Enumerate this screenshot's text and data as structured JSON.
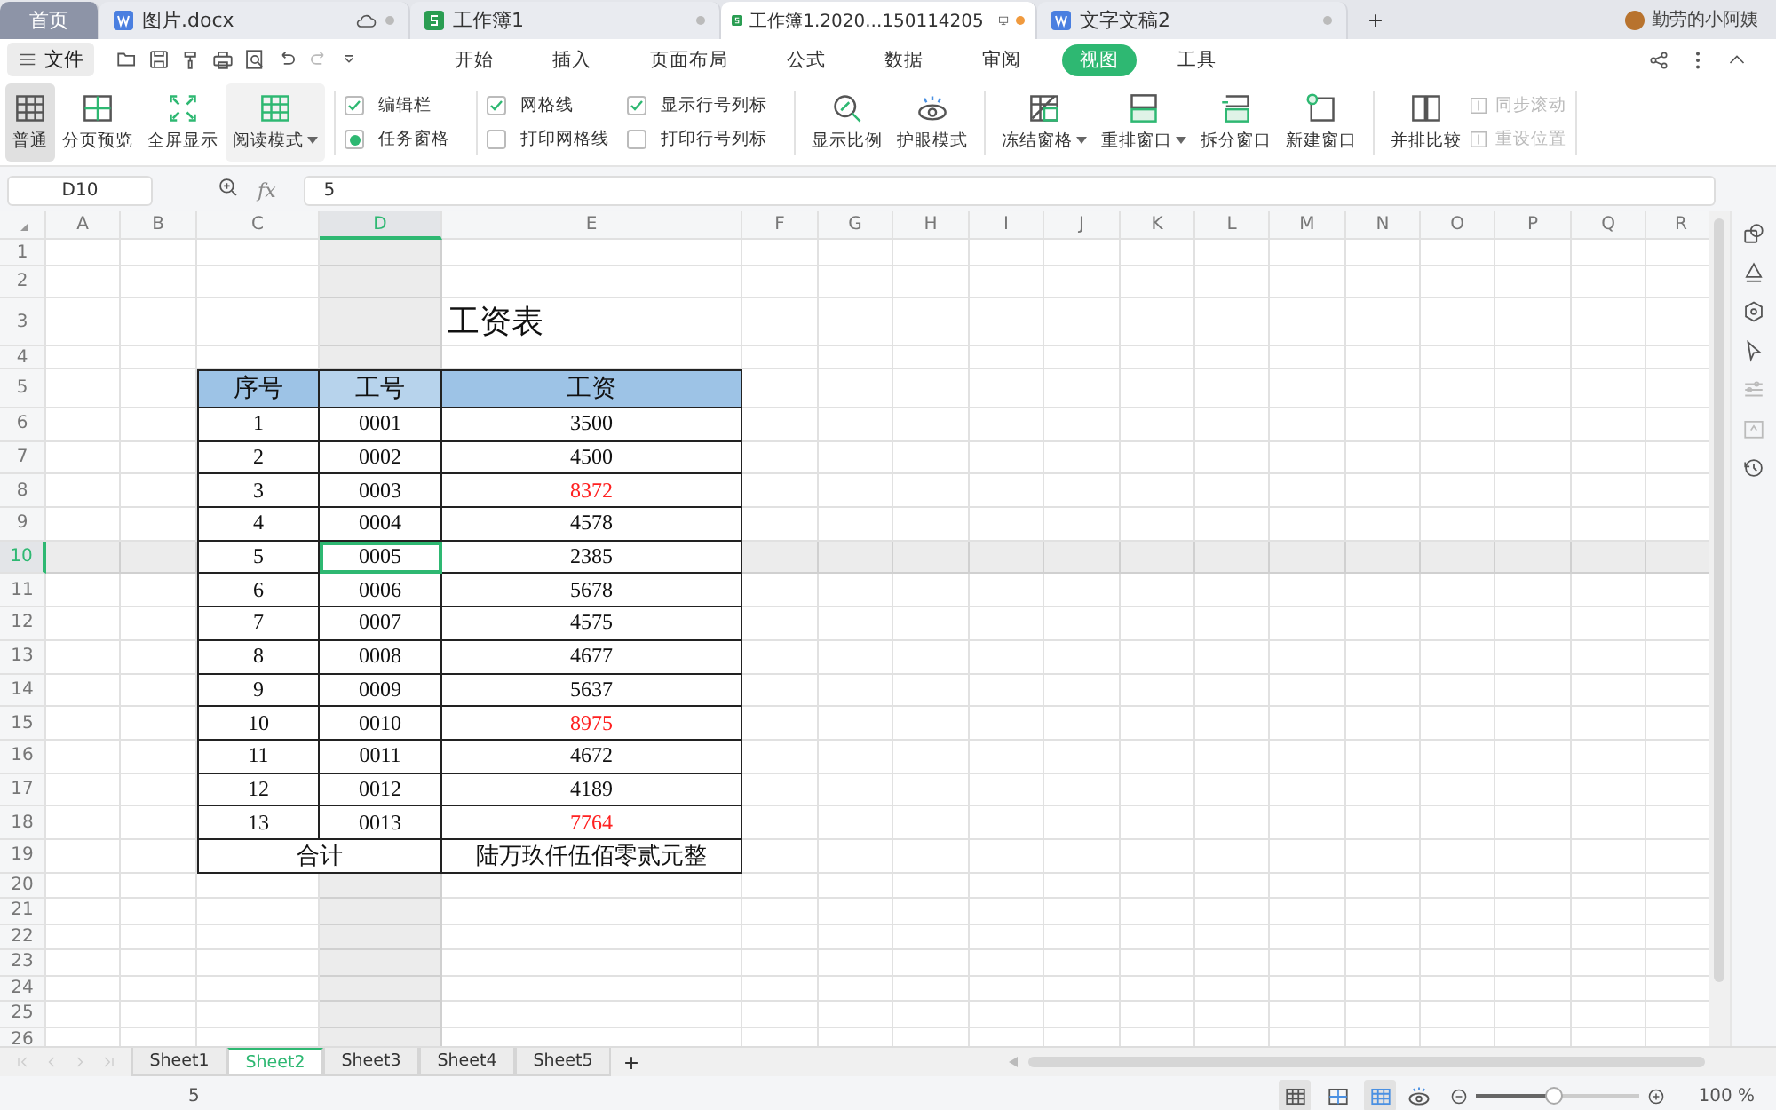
{
  "tabs": [
    {
      "label": "首页",
      "kind": "home",
      "selected": false
    },
    {
      "label": "图片.docx",
      "kind": "doc",
      "selected": false,
      "modified": false,
      "cloud": true
    },
    {
      "label": "工作簿1",
      "kind": "sheet",
      "selected": false,
      "modified": false
    },
    {
      "label": "工作簿1.2020...150114205",
      "kind": "sheet",
      "selected": true,
      "modified": true
    },
    {
      "label": "文字文稿2",
      "kind": "doc",
      "selected": false,
      "modified": false
    }
  ],
  "user": {
    "name": "勤劳的小阿姨"
  },
  "menu": {
    "file": "文件",
    "items": [
      {
        "label": "开始",
        "selected": false
      },
      {
        "label": "插入",
        "selected": false
      },
      {
        "label": "页面布局",
        "selected": false
      },
      {
        "label": "公式",
        "selected": false
      },
      {
        "label": "数据",
        "selected": false
      },
      {
        "label": "审阅",
        "selected": false
      },
      {
        "label": "视图",
        "selected": true
      },
      {
        "label": "工具",
        "selected": false
      }
    ]
  },
  "ribbon": {
    "views": [
      {
        "label": "普通",
        "kind": "grid",
        "selected": true,
        "dropdown": false
      },
      {
        "label": "分页预览",
        "kind": "page",
        "selected": false,
        "dropdown": false
      },
      {
        "label": "全屏显示",
        "kind": "full",
        "selected": false,
        "dropdown": false
      },
      {
        "label": "阅读模式",
        "kind": "read",
        "selected": false,
        "dropdown": true
      }
    ],
    "options": [
      [
        {
          "label": "编辑栏",
          "kind": "checkbox",
          "checked": true
        },
        {
          "label": "任务窗格",
          "kind": "radio",
          "checked": true
        }
      ],
      [
        {
          "label": "网格线",
          "kind": "checkbox",
          "checked": true
        },
        {
          "label": "打印网格线",
          "kind": "checkbox",
          "checked": false
        }
      ],
      [
        {
          "label": "显示行号列标",
          "kind": "checkbox",
          "checked": true
        },
        {
          "label": "打印行号列标",
          "kind": "checkbox",
          "checked": false
        }
      ]
    ],
    "tools": [
      {
        "label": "显示比例",
        "kind": "zoom",
        "dropdown": false
      },
      {
        "label": "护眼模式",
        "kind": "eye",
        "dropdown": false
      },
      {
        "label": "冻结窗格",
        "kind": "freeze",
        "dropdown": true
      },
      {
        "label": "重排窗口",
        "kind": "arrange",
        "dropdown": true
      },
      {
        "label": "拆分窗口",
        "kind": "split",
        "dropdown": false
      },
      {
        "label": "新建窗口",
        "kind": "newwin",
        "dropdown": false
      },
      {
        "label": "并排比较",
        "kind": "compare",
        "dropdown": false
      }
    ],
    "small": [
      {
        "label": "同步滚动",
        "disabled": true
      },
      {
        "label": "重设位置",
        "disabled": true
      }
    ]
  },
  "formula_bar": {
    "name_box": "D10",
    "fx": "fx",
    "value": "5"
  },
  "sheet": {
    "columns": [
      {
        "label": "A",
        "selected": false
      },
      {
        "label": "B",
        "selected": false
      },
      {
        "label": "C",
        "selected": false
      },
      {
        "label": "D",
        "selected": true
      },
      {
        "label": "E",
        "selected": false
      },
      {
        "label": "F",
        "selected": false
      },
      {
        "label": "G",
        "selected": false
      },
      {
        "label": "H",
        "selected": false
      },
      {
        "label": "I",
        "selected": false
      },
      {
        "label": "J",
        "selected": false
      },
      {
        "label": "K",
        "selected": false
      },
      {
        "label": "L",
        "selected": false
      },
      {
        "label": "M",
        "selected": false
      },
      {
        "label": "N",
        "selected": false
      },
      {
        "label": "O",
        "selected": false
      },
      {
        "label": "P",
        "selected": false
      },
      {
        "label": "Q",
        "selected": false
      },
      {
        "label": "R",
        "selected": false
      }
    ],
    "rows": [
      {
        "label": "1",
        "selected": false
      },
      {
        "label": "2",
        "selected": false
      },
      {
        "label": "3",
        "selected": false
      },
      {
        "label": "4",
        "selected": false
      },
      {
        "label": "5",
        "selected": false
      },
      {
        "label": "6",
        "selected": false
      },
      {
        "label": "7",
        "selected": false
      },
      {
        "label": "8",
        "selected": false
      },
      {
        "label": "9",
        "selected": false
      },
      {
        "label": "10",
        "selected": true
      },
      {
        "label": "11",
        "selected": false
      },
      {
        "label": "12",
        "selected": false
      },
      {
        "label": "13",
        "selected": false
      },
      {
        "label": "14",
        "selected": false
      },
      {
        "label": "15",
        "selected": false
      },
      {
        "label": "16",
        "selected": false
      },
      {
        "label": "17",
        "selected": false
      },
      {
        "label": "18",
        "selected": false
      },
      {
        "label": "19",
        "selected": false
      },
      {
        "label": "20",
        "selected": false
      },
      {
        "label": "21",
        "selected": false
      },
      {
        "label": "22",
        "selected": false
      },
      {
        "label": "23",
        "selected": false
      },
      {
        "label": "24",
        "selected": false
      },
      {
        "label": "25",
        "selected": false
      },
      {
        "label": "26",
        "selected": false
      }
    ],
    "title": "工资表",
    "table": {
      "headers": [
        "序号",
        "工号",
        "工资"
      ],
      "rows": [
        {
          "no": "1",
          "id": "0001",
          "salary": "3500",
          "flagged": false
        },
        {
          "no": "2",
          "id": "0002",
          "salary": "4500",
          "flagged": false
        },
        {
          "no": "3",
          "id": "0003",
          "salary": "8372",
          "flagged": true
        },
        {
          "no": "4",
          "id": "0004",
          "salary": "4578",
          "flagged": false
        },
        {
          "no": "5",
          "id": "0005",
          "salary": "2385",
          "flagged": false
        },
        {
          "no": "6",
          "id": "0006",
          "salary": "5678",
          "flagged": false
        },
        {
          "no": "7",
          "id": "0007",
          "salary": "4575",
          "flagged": false
        },
        {
          "no": "8",
          "id": "0008",
          "salary": "4677",
          "flagged": false
        },
        {
          "no": "9",
          "id": "0009",
          "salary": "5637",
          "flagged": false
        },
        {
          "no": "10",
          "id": "0010",
          "salary": "8975",
          "flagged": true
        },
        {
          "no": "11",
          "id": "0011",
          "salary": "4672",
          "flagged": false
        },
        {
          "no": "12",
          "id": "0012",
          "salary": "4189",
          "flagged": false
        },
        {
          "no": "13",
          "id": "0013",
          "salary": "7764",
          "flagged": true
        }
      ],
      "total_label": "合计",
      "total_value": "陆万玖仟伍佰零贰元整"
    }
  },
  "sheet_tabs": [
    {
      "label": "Sheet1",
      "selected": false
    },
    {
      "label": "Sheet2",
      "selected": true
    },
    {
      "label": "Sheet3",
      "selected": false
    },
    {
      "label": "Sheet4",
      "selected": false
    },
    {
      "label": "Sheet5",
      "selected": false
    }
  ],
  "status_bar": {
    "value": "5",
    "zoom": "100 %",
    "level": 0.48
  }
}
